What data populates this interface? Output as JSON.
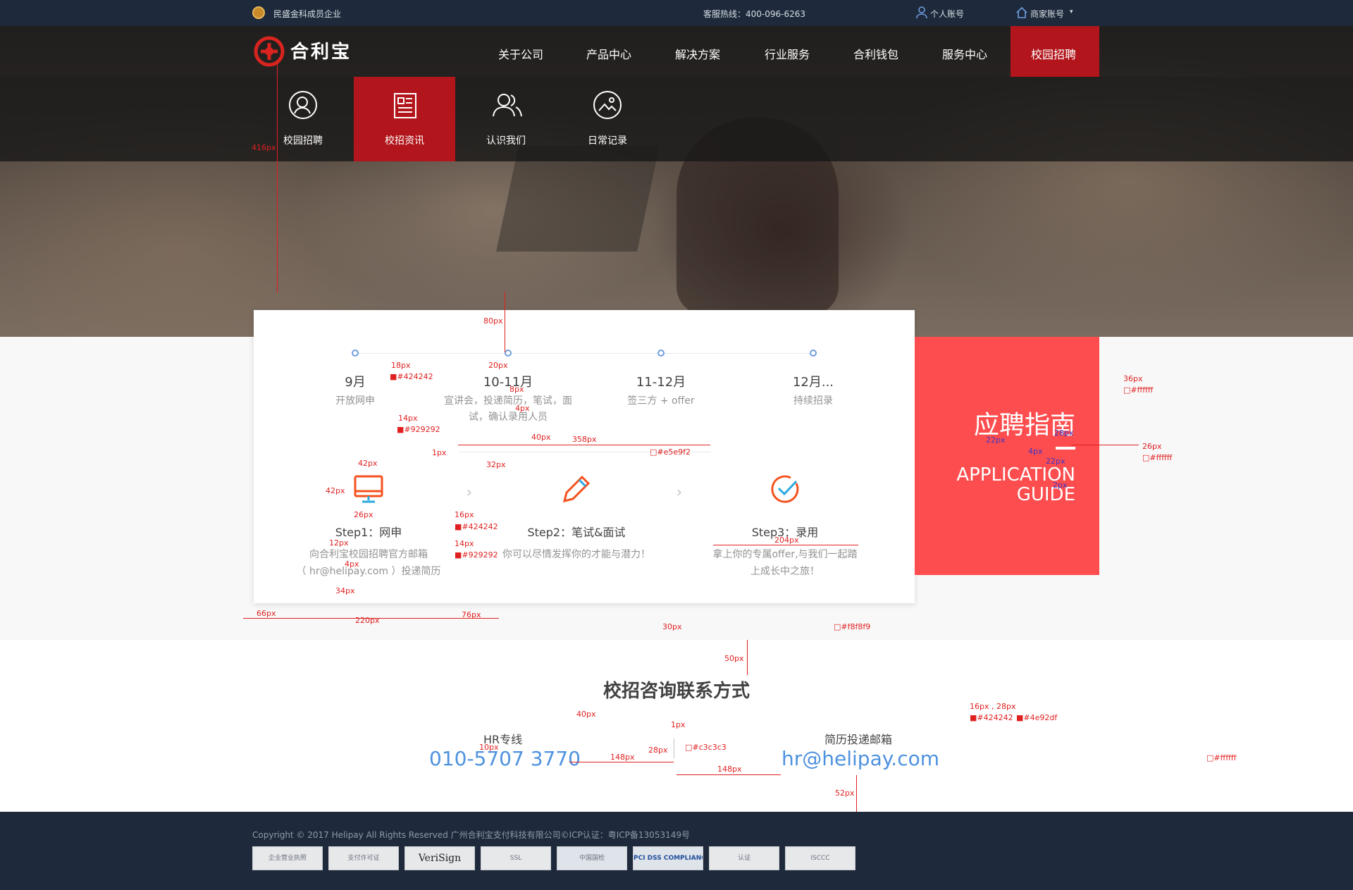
{
  "topbar": {
    "member_text": "民盛金科成员企业",
    "hotline": "客服热线：400-096-6263",
    "personal_account": "个人账号",
    "merchant_account": "商家账号"
  },
  "brand": {
    "logo_text": "合利宝"
  },
  "nav": {
    "items": [
      "关于公司",
      "产品中心",
      "解决方案",
      "行业服务",
      "合利钱包",
      "服务中心",
      "校园招聘"
    ],
    "active_index": 6
  },
  "subnav": {
    "items": [
      {
        "label": "校园招聘",
        "icon": "person-search-icon"
      },
      {
        "label": "校招资讯",
        "icon": "news-list-icon"
      },
      {
        "label": "认识我们",
        "icon": "team-icon"
      },
      {
        "label": "日常记录",
        "icon": "photo-icon"
      }
    ],
    "active_index": 1
  },
  "timeline": [
    {
      "title": "9月",
      "desc": "开放网申"
    },
    {
      "title": "10-11月",
      "desc": "宣讲会，投递简历，笔试，面试，确认录用人员"
    },
    {
      "title": "11-12月",
      "desc": "签三方 + offer"
    },
    {
      "title": "12月...",
      "desc": "持续招录"
    }
  ],
  "steps": [
    {
      "title": "Step1：网申",
      "desc_1": "向合利宝校园招聘官方邮箱",
      "desc_2": "（ hr@helipay.com ）投递简历",
      "icon": "monitor-icon"
    },
    {
      "title": "Step2：笔试&面试",
      "desc_1": "你可以尽情发挥你的才能与潜力！",
      "desc_2": "",
      "icon": "pencil-icon"
    },
    {
      "title": "Step3：录用",
      "desc_1": "拿上你的专属offer,与我们一起踏",
      "desc_2": "上成长中之旅！",
      "icon": "check-circle-icon"
    }
  ],
  "guide": {
    "title": "应聘指南",
    "en_1": "APPLICATION",
    "en_2": "GUIDE"
  },
  "contact": {
    "title": "校招咨询联系方式",
    "hr_label": "HR专线",
    "hr_phone": "010-5707 3770",
    "email_label": "简历投递邮箱",
    "email": "hr@helipay.com"
  },
  "footer": {
    "copyright": "Copyright © 2017 Helipay All Rights Reserved    广州合利宝支付科技有限公司©ICP认证：粤ICP备13053149号",
    "badges": [
      "企业营业执照",
      "支付许可证",
      "VeriSign",
      "SSL",
      "中国国检",
      "PCI DSS COMPLIANCE",
      "认证",
      "ISCCC"
    ]
  },
  "colors": {
    "brand_red": "#b2151b",
    "guide_red": "#fd4d4e",
    "text_dark": "#424242",
    "text_gray": "#929292",
    "link_blue": "#4e92df",
    "divider": "#e5e9f2",
    "separator": "#c3c3c3",
    "page_bg": "#f8f8f9",
    "topbar_bg": "#1e2a3b"
  },
  "annotations": {
    "a416": "416px",
    "a80": "80px",
    "a18": "18px",
    "c424242": "■#424242",
    "a20": "20px",
    "a8": "8px",
    "a4": "4px",
    "a14": "14px",
    "c929292": "■#929292",
    "a40": "40px",
    "a358": "358px",
    "a1": "1px",
    "ce5e9f2": "□#e5e9f2",
    "a32": "32px",
    "a42w": "42px",
    "a42h": "42px",
    "a26": "26px",
    "a16": "16px",
    "c424242b": "■#424242",
    "a12": "12px",
    "a14b": "14px",
    "c929292b": "■#929292",
    "a4b": "4px",
    "a34": "34px",
    "a204": "204px",
    "a36": "36px",
    "cfff1": "□#ffffff",
    "a22": "22px",
    "a28": "28px",
    "a4c": "4px",
    "a26b": "26px",
    "cfff2": "□#ffffff",
    "a22b": "22px",
    "a2": "2px",
    "a66": "66px",
    "a220": "220px",
    "a76": "76px",
    "a30": "30px",
    "cf8f8f9": "□#f8f8f9",
    "a50": "50px",
    "a40b": "40px",
    "a1b": "1px",
    "cc3c3c3": "□#c3c3c3",
    "a10": "10px",
    "a28b": "28px",
    "a148a": "148px",
    "a148b": "148px",
    "a16_28": "16px , 28px",
    "c424242c": "■#424242",
    "c4e92df": "■#4e92df",
    "a52": "52px",
    "cfff3": "□#ffffff"
  }
}
